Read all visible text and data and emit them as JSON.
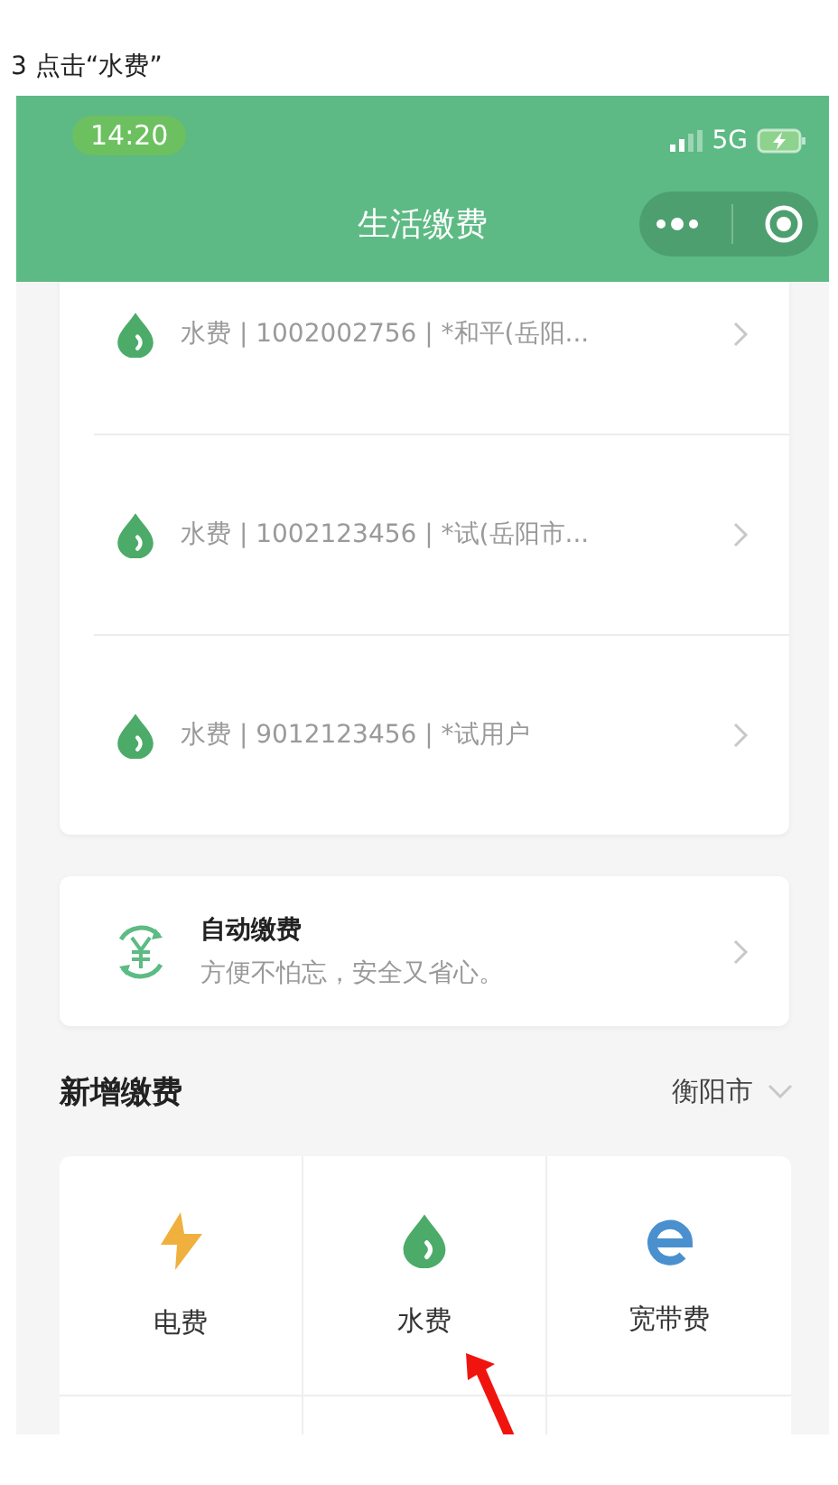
{
  "caption": "3 点击“水费”",
  "status_bar": {
    "time": "14:20",
    "network": "5G"
  },
  "title": "生活缴费",
  "bills": [
    {
      "text": "水费 | 1002002756 | *和平(岳阳..."
    },
    {
      "text": "水费 | 1002123456 | *试(岳阳市..."
    },
    {
      "text": "水费 | 9012123456 | *试用户"
    }
  ],
  "auto_pay": {
    "title": "自动缴费",
    "subtitle": "方便不怕忘，安全又省心。"
  },
  "new_payment": {
    "title": "新增缴费",
    "city": "衡阳市",
    "items": [
      {
        "label": "电费",
        "kind": "electricity"
      },
      {
        "label": "水费",
        "kind": "water"
      },
      {
        "label": "宽带费",
        "kind": "broadband"
      }
    ]
  }
}
